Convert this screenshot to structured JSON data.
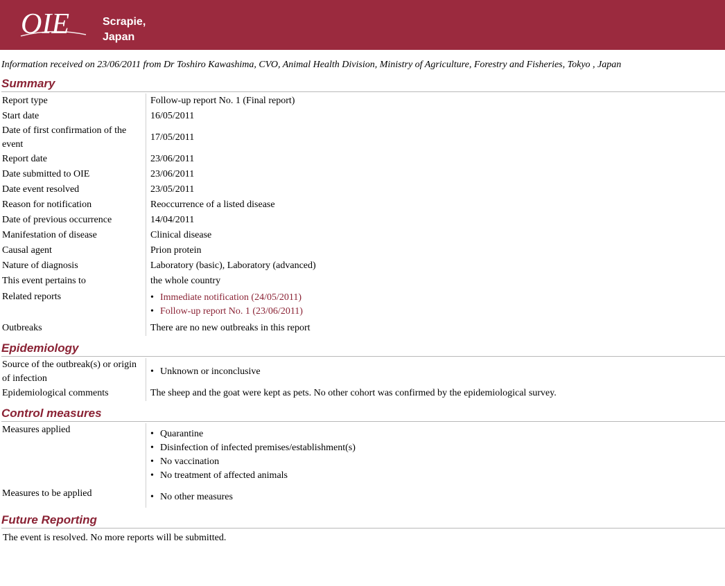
{
  "header": {
    "logo_text": "OIE",
    "title_line1": "Scrapie,",
    "title_line2": "Japan"
  },
  "info": "Information received on 23/06/2011 from Dr Toshiro Kawashima, CVO, Animal Health Division, Ministry of Agriculture, Forestry and Fisheries, Tokyo , Japan",
  "summary": {
    "title": "Summary",
    "rows": [
      {
        "label": "Report type",
        "value": "Follow-up report No. 1 (Final report)"
      },
      {
        "label": "Start date",
        "value": "16/05/2011"
      },
      {
        "label": "Date of first confirmation of the event",
        "value": "17/05/2011"
      },
      {
        "label": "Report date",
        "value": "23/06/2011"
      },
      {
        "label": "Date submitted to OIE",
        "value": "23/06/2011"
      },
      {
        "label": "Date event resolved",
        "value": "23/05/2011"
      },
      {
        "label": "Reason for notification",
        "value": "Reoccurrence of a listed disease"
      },
      {
        "label": "Date of previous occurrence",
        "value": "14/04/2011"
      },
      {
        "label": "Manifestation of disease",
        "value": "Clinical disease"
      },
      {
        "label": "Causal agent",
        "value": "Prion protein"
      },
      {
        "label": "Nature of diagnosis",
        "value": "Laboratory (basic), Laboratory (advanced)"
      },
      {
        "label": "This event pertains to",
        "value": "the whole country"
      }
    ],
    "related_label": "Related reports",
    "related": [
      "Immediate notification (24/05/2011)",
      "Follow-up report No. 1 (23/06/2011)"
    ],
    "outbreaks_label": "Outbreaks",
    "outbreaks_value": "There are no new outbreaks in this report"
  },
  "epidemiology": {
    "title": "Epidemiology",
    "source_label": "Source of the outbreak(s) or origin of infection",
    "source_items": [
      "Unknown or inconclusive"
    ],
    "comments_label": "Epidemiological comments",
    "comments_value": "The sheep and the goat were kept as pets. No other cohort was confirmed by the epidemiological survey."
  },
  "control": {
    "title": "Control measures",
    "applied_label": "Measures applied",
    "applied_items": [
      "Quarantine",
      "Disinfection of infected premises/establishment(s)",
      "No vaccination",
      "No treatment of affected animals"
    ],
    "to_apply_label": "Measures to be applied",
    "to_apply_items": [
      "No other measures"
    ]
  },
  "future": {
    "title": "Future Reporting",
    "text": "The event is resolved. No more reports will be submitted."
  },
  "colors": {
    "header_bg": "#9b2a3e",
    "section_title": "#8a2234"
  }
}
